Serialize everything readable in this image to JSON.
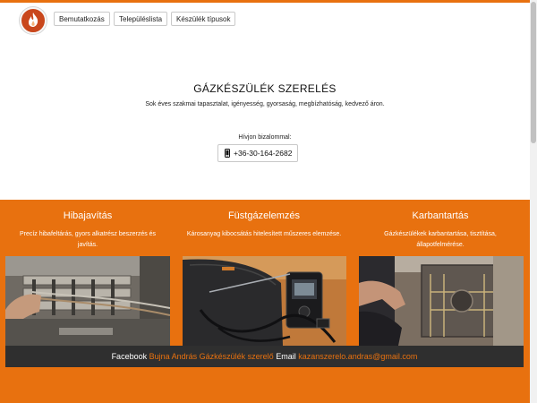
{
  "nav": {
    "items": [
      {
        "label": "Bemutatkozás"
      },
      {
        "label": "Településlista"
      },
      {
        "label": "Készülék típusok"
      }
    ]
  },
  "hero": {
    "title": "GÁZKÉSZÜLÉK SZERELÉS",
    "subtitle": "Sok éves szakmai tapasztalat, igényesség, gyorsaság, megbízhatóság, kedvező áron.",
    "call_label": "Hívjon bizalommal:",
    "phone": "+36-30-164-2682"
  },
  "services": [
    {
      "title": "Hibajavítás",
      "description": "Precíz hibafeltárás, gyors alkatrész beszerzés és javítás."
    },
    {
      "title": "Füstgázelemzés",
      "description": "Károsanyag kibocsátás hitelesített műszeres elemzése."
    },
    {
      "title": "Karbantartás",
      "description": "Gázkészülékek karbantartása, tisztítása, állapotfelmérése."
    }
  ],
  "footer": {
    "facebook_label": "Facebook",
    "facebook_link": "Bujna András Gázkészülék szerelő",
    "email_label": "Email",
    "email_link": "kazanszerelo.andras@gmail.com"
  },
  "colors": {
    "accent": "#e8710f",
    "footer_bg": "#2f2f2f"
  },
  "icons": [
    "flame-logo-icon",
    "phone-icon"
  ]
}
